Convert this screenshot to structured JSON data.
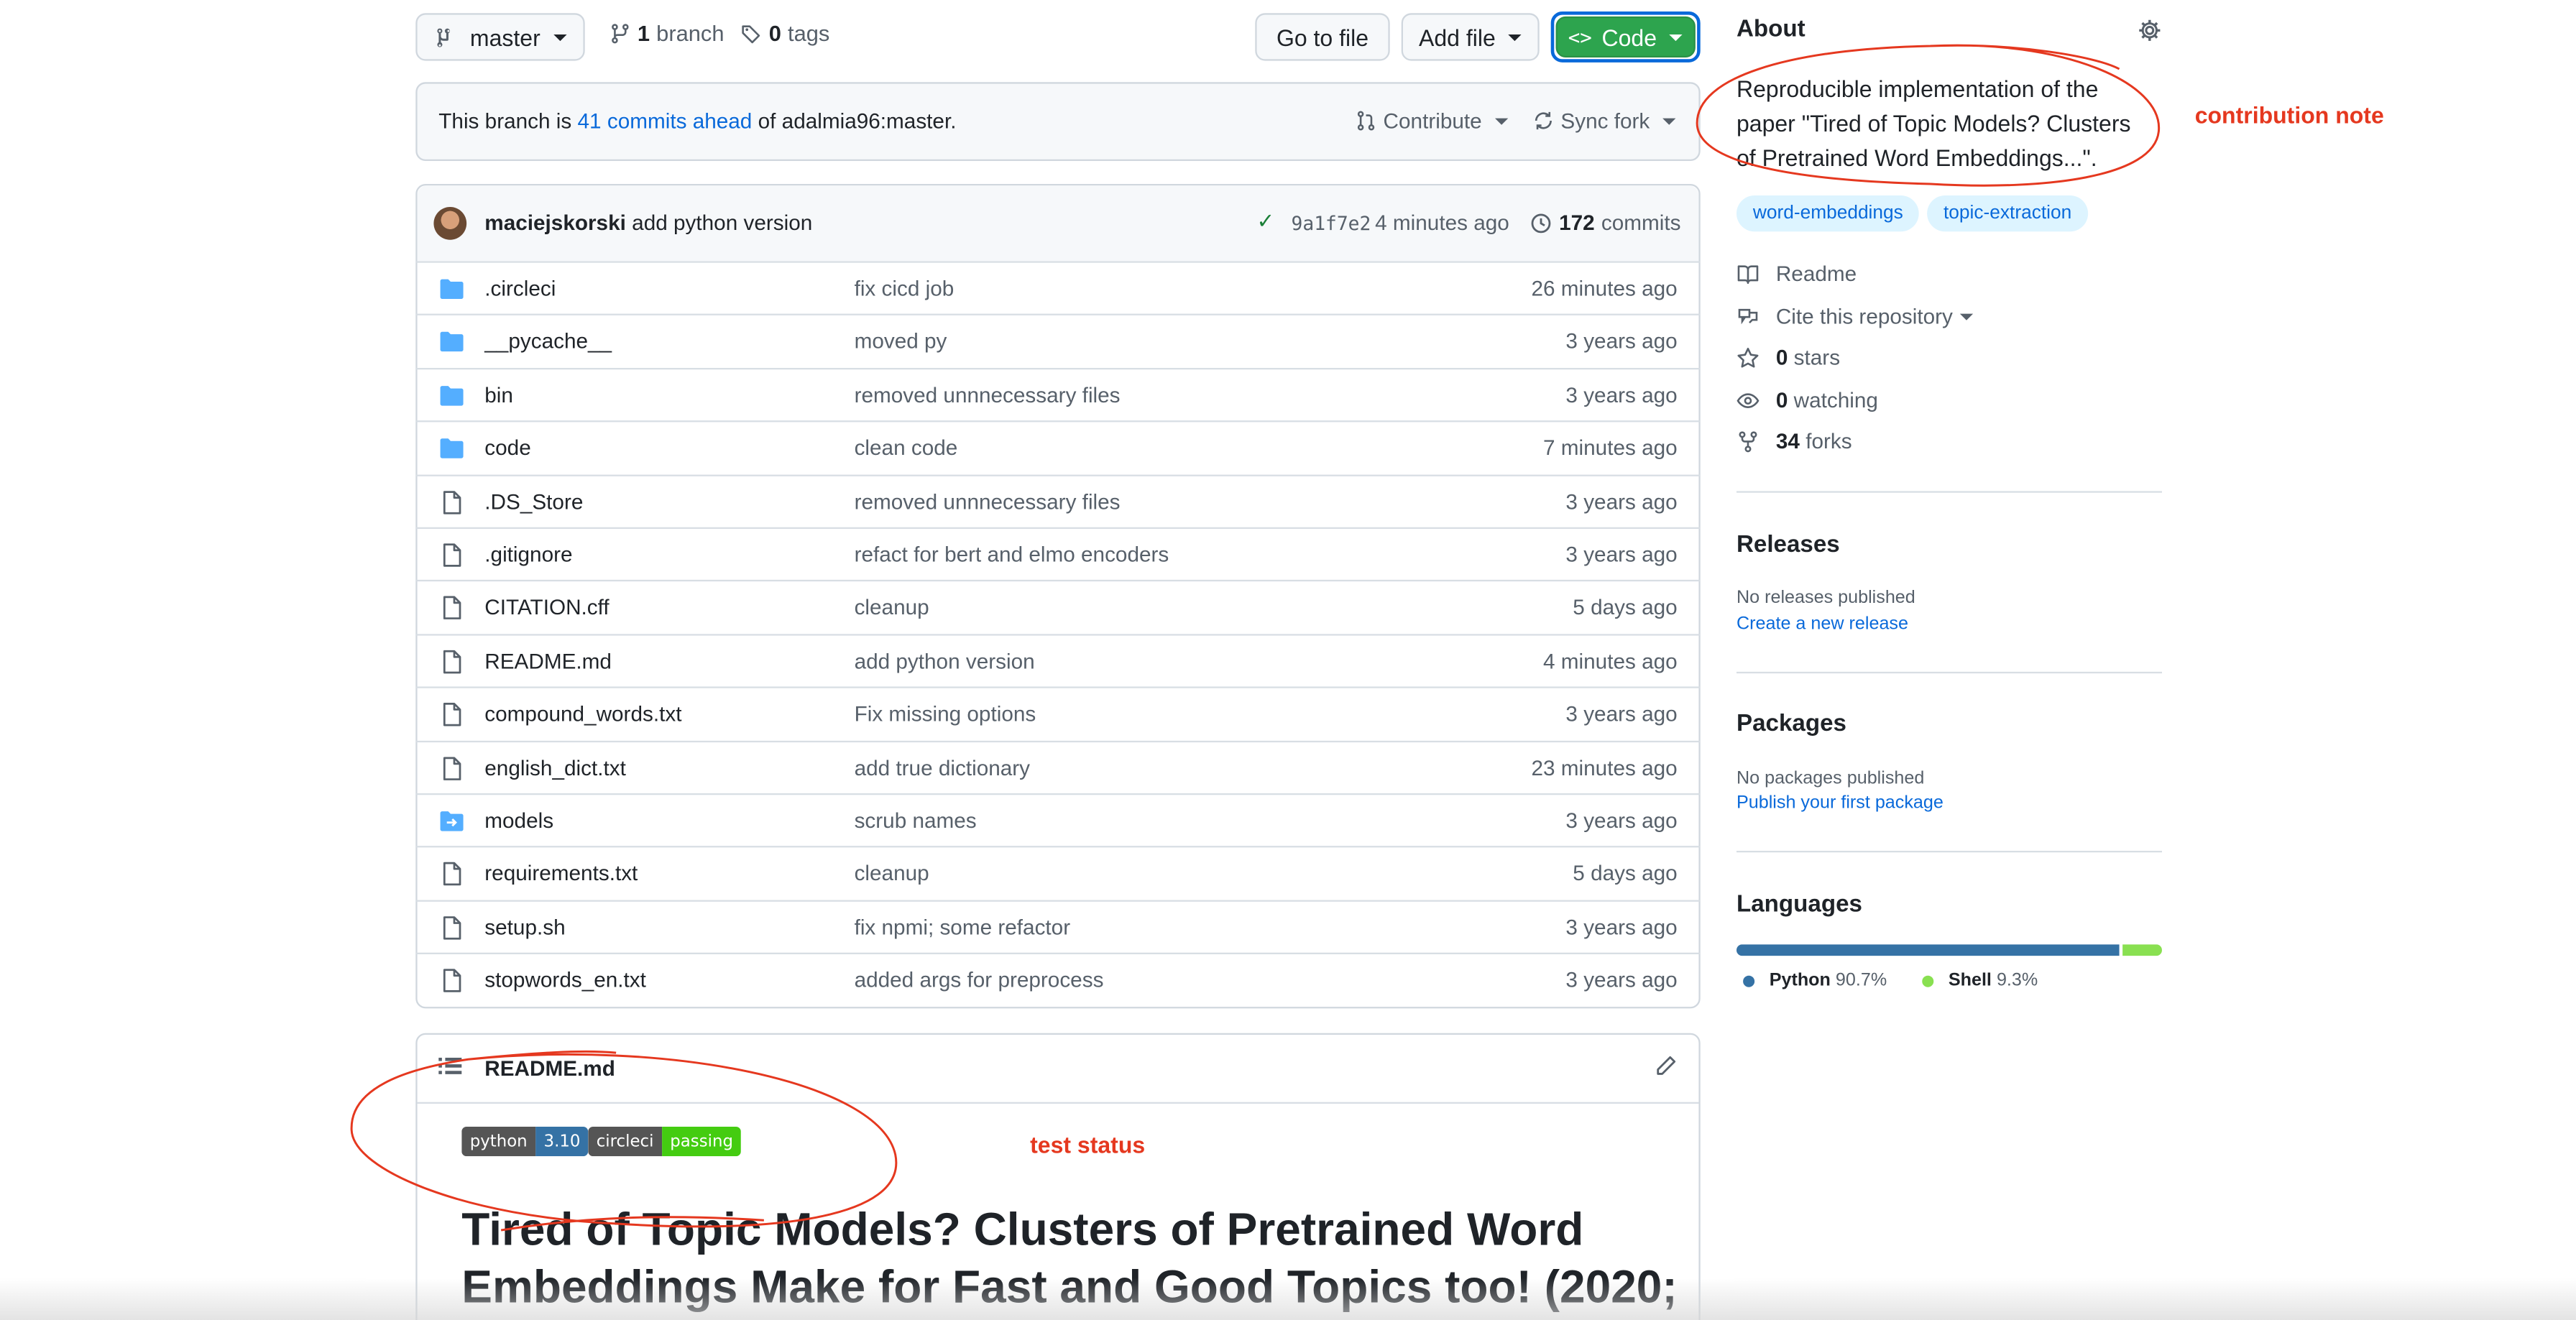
{
  "toolbar": {
    "branch_button": "master",
    "branches_count": "1",
    "branches_label": "branch",
    "tags_count": "0",
    "tags_label": "tags",
    "go_to_file": "Go to file",
    "add_file": "Add file",
    "code": "Code"
  },
  "branch_status": {
    "prefix": "This branch is",
    "ahead_link": "41 commits ahead",
    "suffix": "of adalmia96:master.",
    "contribute": "Contribute",
    "sync_fork": "Sync fork"
  },
  "latest_commit": {
    "author": "maciejskorski",
    "message": "add python version",
    "sha": "9a1f7e2",
    "time": "4 minutes ago",
    "commits_count": "172",
    "commits_label": "commits"
  },
  "files": [
    {
      "name": ".circleci",
      "type": "folder",
      "message": "fix cicd job",
      "age": "26 minutes ago"
    },
    {
      "name": "__pycache__",
      "type": "folder",
      "message": "moved py",
      "age": "3 years ago"
    },
    {
      "name": "bin",
      "type": "folder",
      "message": "removed unnnecessary files",
      "age": "3 years ago"
    },
    {
      "name": "code",
      "type": "folder",
      "message": "clean code",
      "age": "7 minutes ago"
    },
    {
      "name": ".DS_Store",
      "type": "file",
      "message": "removed unnnecessary files",
      "age": "3 years ago"
    },
    {
      "name": ".gitignore",
      "type": "file",
      "message": "refact for bert and elmo encoders",
      "age": "3 years ago"
    },
    {
      "name": "CITATION.cff",
      "type": "file",
      "message": "cleanup",
      "age": "5 days ago"
    },
    {
      "name": "README.md",
      "type": "file",
      "message": "add python version",
      "age": "4 minutes ago"
    },
    {
      "name": "compound_words.txt",
      "type": "file",
      "message": "Fix missing options",
      "age": "3 years ago"
    },
    {
      "name": "english_dict.txt",
      "type": "file",
      "message": "add true dictionary",
      "age": "23 minutes ago"
    },
    {
      "name": "models",
      "type": "submodule",
      "message": "scrub names",
      "age": "3 years ago"
    },
    {
      "name": "requirements.txt",
      "type": "file",
      "message": "cleanup",
      "age": "5 days ago"
    },
    {
      "name": "setup.sh",
      "type": "file",
      "message": "fix npmi; some refactor",
      "age": "3 years ago"
    },
    {
      "name": "stopwords_en.txt",
      "type": "file",
      "message": "added args for preprocess",
      "age": "3 years ago"
    }
  ],
  "readme": {
    "header": "README.md",
    "badge_python_left": "python",
    "badge_python_right": "3.10",
    "badge_ci_left": "circleci",
    "badge_ci_right": "passing",
    "title_line1": "Tired of Topic Models? Clusters of Pretrained Word",
    "title_line2": "Embeddings Make for Fast and Good Topics too! (2020;"
  },
  "about": {
    "heading": "About",
    "description_line1": "Reproducible implementation of the",
    "description_line2": "paper \"Tired of Topic Models? Clusters",
    "description_line3": "of Pretrained Word Embeddings...\".",
    "topics": [
      "word-embeddings",
      "topic-extraction"
    ],
    "readme": "Readme",
    "cite": "Cite this repository",
    "stars_count": "0",
    "stars_label": "stars",
    "watching_count": "0",
    "watching_label": "watching",
    "forks_count": "34",
    "forks_label": "forks"
  },
  "releases": {
    "heading": "Releases",
    "none": "No releases published",
    "create": "Create a new release"
  },
  "packages": {
    "heading": "Packages",
    "none": "No packages published",
    "publish": "Publish your first package"
  },
  "languages": {
    "heading": "Languages",
    "items": [
      {
        "name": "Python",
        "percent": 90.7,
        "label": "90.7%",
        "color": "#3572A5"
      },
      {
        "name": "Shell",
        "percent": 9.3,
        "label": "9.3%",
        "color": "#89e051"
      }
    ]
  },
  "annotations": {
    "contribution_note": "contribution note",
    "test_status": "test status"
  },
  "colors": {
    "accent": "#0969da",
    "code_button": "#2da44e",
    "annotation": "#e5381f"
  }
}
